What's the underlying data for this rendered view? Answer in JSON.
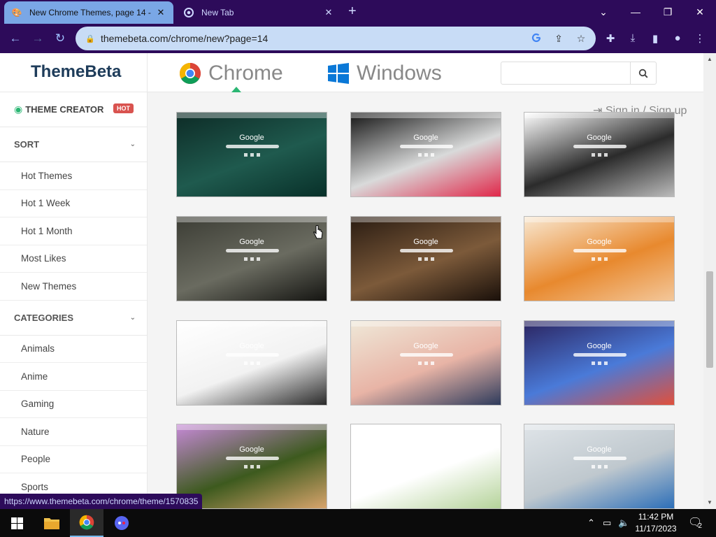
{
  "browser": {
    "tabs": [
      {
        "title": "New Chrome Themes, page 14 -",
        "close": "✕",
        "active": true
      },
      {
        "title": "New Tab",
        "close": "✕",
        "active": false
      }
    ],
    "new_tab_symbol": "+",
    "window_controls": {
      "tab_search": "⌄",
      "minimize": "—",
      "restore": "❐",
      "close": "✕"
    },
    "url": "themebeta.com/chrome/new?page=14",
    "status_url": "https://www.themebeta.com/chrome/theme/1570835"
  },
  "site": {
    "brand": "ThemeBeta",
    "platforms": [
      {
        "label": "Chrome",
        "active": true
      },
      {
        "label": "Windows",
        "active": false
      }
    ],
    "search": {
      "placeholder": "",
      "value": ""
    },
    "signin": "Sign in / Sign up",
    "accent": "#2bb673"
  },
  "sidebar": {
    "theme_creator": "THEME CREATOR",
    "hot_badge": "HOT",
    "sort": {
      "label": "SORT",
      "items": [
        {
          "label": "Hot Themes"
        },
        {
          "label": "Hot 1 Week"
        },
        {
          "label": "Hot 1 Month"
        },
        {
          "label": "Most Likes"
        },
        {
          "label": "New Themes"
        }
      ]
    },
    "categories": {
      "label": "CATEGORIES",
      "items": [
        {
          "label": "Animals"
        },
        {
          "label": "Anime"
        },
        {
          "label": "Gaming"
        },
        {
          "label": "Nature"
        },
        {
          "label": "People"
        },
        {
          "label": "Sports"
        }
      ]
    }
  },
  "themes": [
    {
      "google": "Google",
      "colors": [
        "#0d2b26",
        "#1f5a4e",
        "#083029"
      ]
    },
    {
      "google": "Google",
      "colors": [
        "#141414",
        "#d9dada",
        "#e0284a"
      ]
    },
    {
      "google": "Google",
      "colors": [
        "#ffffff",
        "#2b2b2b",
        "#bbbbbb"
      ]
    },
    {
      "google": "Google",
      "colors": [
        "#3c3d35",
        "#6a6b60",
        "#151512"
      ]
    },
    {
      "google": "Google",
      "colors": [
        "#2a1c12",
        "#7c5a3a",
        "#1a100a"
      ]
    },
    {
      "google": "Google",
      "colors": [
        "#f8e8d2",
        "#e8892e",
        "#f3c79a"
      ]
    },
    {
      "google": "Google",
      "colors": [
        "#ffffff",
        "#f2f2f2",
        "#2a2a2a"
      ]
    },
    {
      "google": "Google",
      "colors": [
        "#efe8d8",
        "#e8b4a6",
        "#2e3b5c"
      ]
    },
    {
      "google": "Google",
      "colors": [
        "#2b2460",
        "#4a7ad8",
        "#e0503c"
      ]
    },
    {
      "google": "Google",
      "colors": [
        "#c78ad8",
        "#3d5a1e",
        "#d8a46c"
      ]
    },
    {
      "google": "",
      "colors": [
        "#ffffff",
        "#ffffff",
        "#b5d39a"
      ]
    },
    {
      "google": "Google",
      "colors": [
        "#dfe4e8",
        "#bfc8ce",
        "#2d6fb8"
      ]
    }
  ],
  "taskbar": {
    "time": "11:42 PM",
    "date": "11/17/2023",
    "notifications": "2"
  }
}
